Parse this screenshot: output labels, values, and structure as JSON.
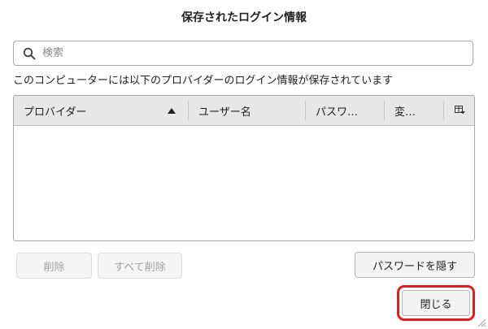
{
  "dialog": {
    "title": "保存されたログイン情報",
    "description": "このコンピューターには以下のプロバイダーのログイン情報が保存されています"
  },
  "search": {
    "placeholder": "検索",
    "value": ""
  },
  "table": {
    "columns": [
      {
        "label": "プロバイダー",
        "sorted": "ascending"
      },
      {
        "label": "ユーザー名"
      },
      {
        "label": "パスワ…"
      },
      {
        "label": "変…"
      }
    ],
    "column_picker_icon": "column-picker-icon",
    "rows": []
  },
  "buttons": {
    "remove_label": "削除",
    "remove_all_label": "すべて削除",
    "toggle_passwords_label": "パスワードを隠す",
    "close_label": "閉じる"
  },
  "colors": {
    "highlight_ring": "#e31b1b",
    "header_background": "#e7e7e7",
    "disabled_text": "#a2a2a2"
  }
}
